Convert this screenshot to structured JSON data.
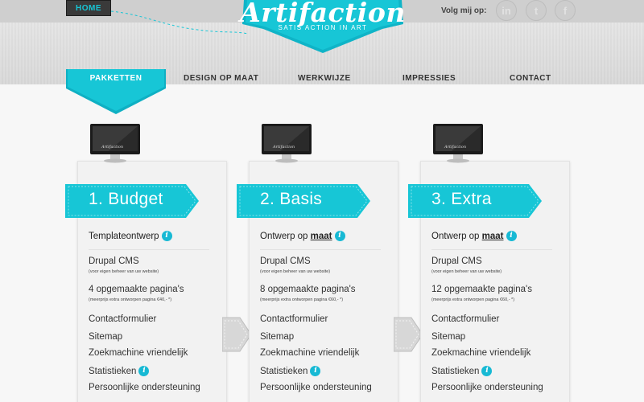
{
  "header": {
    "home_label": "HOME",
    "logo_title": "Artifaction",
    "logo_tagline": "SATIS ACTION IN ART",
    "follow_label": "Volg mij op:",
    "social_icons": [
      "linkedin-icon",
      "twitter-icon",
      "facebook-icon"
    ],
    "social_glyphs": [
      "in",
      "t",
      "f"
    ]
  },
  "nav": {
    "items": [
      "PAKKETTEN",
      "DESIGN OP MAAT",
      "WERKWIJZE",
      "IMPRESSIES",
      "CONTACT"
    ],
    "active_index": 0
  },
  "colors": {
    "accent": "#17c6d6",
    "accent_dark": "#0ea9bd",
    "text": "#333333"
  },
  "packages": [
    {
      "title": "1. Budget",
      "feature_title": "Templateontwerp",
      "feature_title_link": "",
      "lines": [
        {
          "text": "Drupal CMS",
          "sub": "(voor eigen beheer van uw website)"
        },
        {
          "text": "4 opgemaakte pagina's",
          "sub": "(meerprijs extra ontworpen pagina €40,- *)"
        },
        {
          "text": "Contactformulier",
          "sub": ""
        },
        {
          "text": "Sitemap",
          "sub": ""
        },
        {
          "text": "Zoekmachine vriendelijk",
          "sub": ""
        },
        {
          "text": "Statistieken",
          "sub": "",
          "info": true
        },
        {
          "text": "Persoonlijke ondersteuning",
          "sub": ""
        }
      ]
    },
    {
      "title": "2. Basis",
      "feature_title": "Ontwerp op ",
      "feature_title_link": "maat",
      "lines": [
        {
          "text": "Drupal CMS",
          "sub": "(voor eigen beheer van uw website)"
        },
        {
          "text": "8 opgemaakte pagina's",
          "sub": "(meerprijs extra ontworpen pagina €60,- *)"
        },
        {
          "text": "Contactformulier",
          "sub": ""
        },
        {
          "text": "Sitemap",
          "sub": ""
        },
        {
          "text": "Zoekmachine vriendelijk",
          "sub": ""
        },
        {
          "text": "Statistieken",
          "sub": "",
          "info": true
        },
        {
          "text": "Persoonlijke ondersteuning",
          "sub": ""
        }
      ]
    },
    {
      "title": "3. Extra",
      "feature_title": "Ontwerp op ",
      "feature_title_link": "maat",
      "lines": [
        {
          "text": "Drupal CMS",
          "sub": "(voor eigen beheer van uw website)"
        },
        {
          "text": "12 opgemaakte pagina's",
          "sub": "(meerprijs extra ontworpen pagina €60,- *)"
        },
        {
          "text": "Contactformulier",
          "sub": ""
        },
        {
          "text": "Sitemap",
          "sub": ""
        },
        {
          "text": "Zoekmachine vriendelijk",
          "sub": ""
        },
        {
          "text": "Statistieken",
          "sub": "",
          "info": true
        },
        {
          "text": "Persoonlijke ondersteuning",
          "sub": ""
        }
      ]
    }
  ],
  "monitor_brand": "Artifaction",
  "info_glyph": "i"
}
